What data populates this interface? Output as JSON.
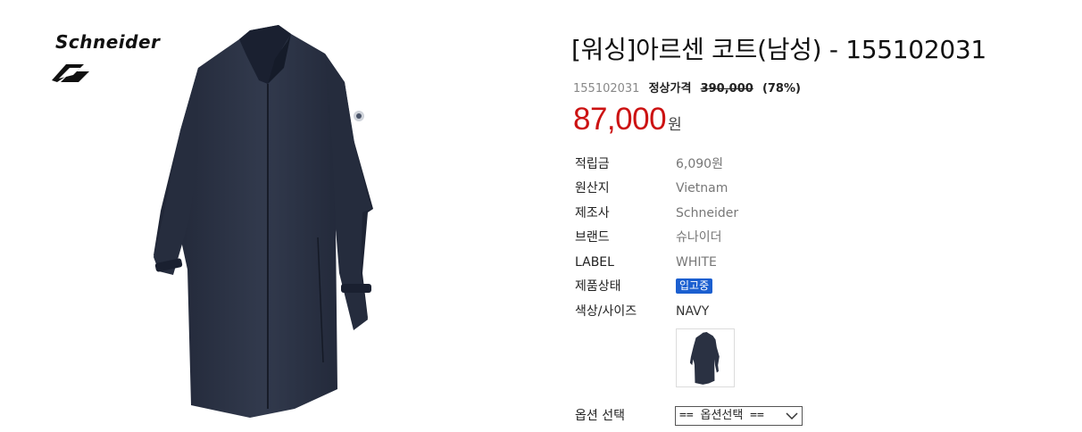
{
  "brand_logo": {
    "text": "Schneider"
  },
  "product": {
    "title": "[워싱]아르센 코트(남성) - 155102031",
    "code": "155102031",
    "regular_price_label": "정상가격",
    "regular_price": "390,000",
    "discount": "(78%)",
    "price": "87,000",
    "price_unit": "원",
    "image_alt": "navy coat"
  },
  "details": [
    {
      "label": "적립금",
      "value": "6,090원"
    },
    {
      "label": "원산지",
      "value": "Vietnam"
    },
    {
      "label": "제조사",
      "value": "Schneider"
    },
    {
      "label": "브랜드",
      "value": "슈나이더"
    },
    {
      "label": "LABEL",
      "value": "WHITE"
    },
    {
      "label": "제품상태",
      "value": "입고중"
    },
    {
      "label": "색상/사이즈",
      "value": "NAVY"
    }
  ],
  "option": {
    "label": "옵션 선택",
    "selected": "== 옵션선택 =="
  },
  "colors": {
    "price": "#cc1212",
    "badge": "#1b5fd0",
    "coat": "#2a3142"
  }
}
